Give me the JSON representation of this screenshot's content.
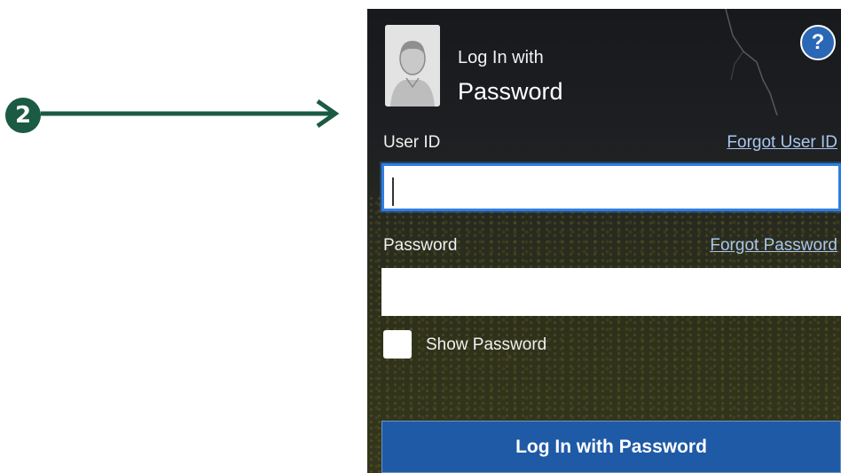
{
  "annotation": {
    "step_number": "2",
    "color": "#1b5a43"
  },
  "login": {
    "title_small": "Log In with",
    "title_large": "Password",
    "help_symbol": "?",
    "user_id_label": "User ID",
    "forgot_user_id": "Forgot User ID",
    "user_id_value": "",
    "password_label": "Password",
    "forgot_password": "Forgot Password",
    "password_value": "",
    "show_password_label": "Show Password",
    "show_password_checked": false,
    "submit_label": "Log In with Password"
  },
  "colors": {
    "accent": "#1f5aa6",
    "help": "#2a67b5",
    "focus": "#2f7fe0",
    "link": "#a9c6ef"
  },
  "icons": {
    "avatar": "user-silhouette-icon",
    "help": "question-mark-icon",
    "arrow": "right-arrow-icon"
  }
}
